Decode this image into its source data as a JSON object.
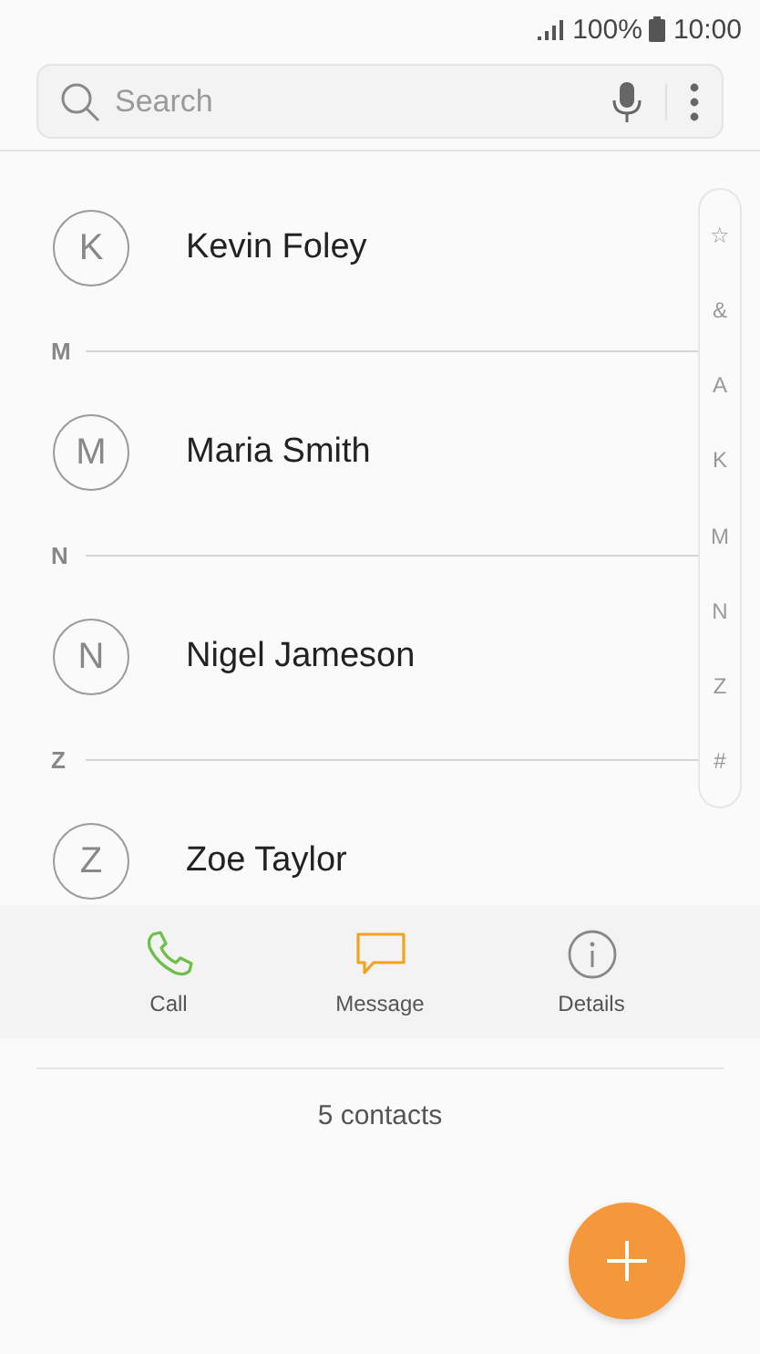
{
  "status_bar": {
    "battery": "100%",
    "time": "10:00"
  },
  "search": {
    "placeholder": "Search"
  },
  "items": [
    {
      "kind": "contact",
      "initial": "K",
      "name": "Kevin Foley"
    },
    {
      "kind": "header",
      "letter": "M"
    },
    {
      "kind": "contact",
      "initial": "M",
      "name": "Maria Smith"
    },
    {
      "kind": "header",
      "letter": "N"
    },
    {
      "kind": "contact",
      "initial": "N",
      "name": "Nigel Jameson"
    },
    {
      "kind": "header",
      "letter": "Z"
    },
    {
      "kind": "contact",
      "initial": "Z",
      "name": "Zoe Taylor"
    }
  ],
  "index": [
    "☆",
    "&",
    "A",
    "K",
    "M",
    "N",
    "Z",
    "#"
  ],
  "actions": [
    {
      "kind": "call",
      "label": "Call"
    },
    {
      "kind": "message",
      "label": "Message"
    },
    {
      "kind": "details",
      "label": "Details"
    }
  ],
  "footer": {
    "count": "5 contacts"
  }
}
